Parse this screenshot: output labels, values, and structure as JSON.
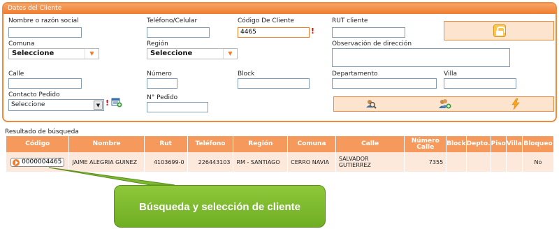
{
  "panel": {
    "title": "Datos del Cliente"
  },
  "form": {
    "nombre_label": "Nombre o razón social",
    "nombre_value": "",
    "telefono_label": "Teléfono/Celular",
    "telefono_value": "",
    "codigo_label": "Código De Cliente",
    "codigo_value": "4465",
    "rut_label": "RUT cliente",
    "rut_value": "",
    "comuna_label": "Comuna",
    "comuna_value": "Seleccione",
    "region_label": "Región",
    "region_value": "Seleccione",
    "obs_label": "Observación de dirección",
    "calle_label": "Calle",
    "numero_label": "Número",
    "block_label": "Block",
    "depto_label": "Departamento",
    "villa_label": "Villa",
    "contacto_label": "Contacto Pedido",
    "contacto_value": "Seleccione",
    "pedido_label": "N° Pedido",
    "required_mark": "!"
  },
  "icons": {
    "lock": "lock-icon",
    "search_user": "search-user-icon",
    "add_user": "add-user-icon",
    "lightning": "lightning-icon",
    "calendar_add": "calendar-add-icon"
  },
  "results": {
    "title": "Resultado de búsqueda",
    "columns": [
      "Código",
      "Nombre",
      "Rut",
      "Teléfono",
      "Región",
      "Comuna",
      "Calle",
      "Número Calle",
      "Block",
      "Depto.",
      "Piso",
      "Villa",
      "Bloqueo"
    ],
    "rows": [
      {
        "codigo": "0000004465",
        "nombre": "JAIME ALEGRIA GUINEZ",
        "rut": "4103699-0",
        "telefono": "226443103",
        "region": "RM - SANTIAGO",
        "comuna": "CERRO NAVIA",
        "calle": "SALVADOR GUTIERREZ",
        "numero": "7355",
        "block": "",
        "depto": "",
        "piso": "",
        "villa": "",
        "bloqueo": "No"
      }
    ]
  },
  "callout": {
    "text": "Búsqueda y selección de cliente"
  },
  "colors": {
    "accent": "#f07d2d",
    "header": "#f59a5c",
    "row": "#fde9dc",
    "callout": "#7cb82f"
  }
}
